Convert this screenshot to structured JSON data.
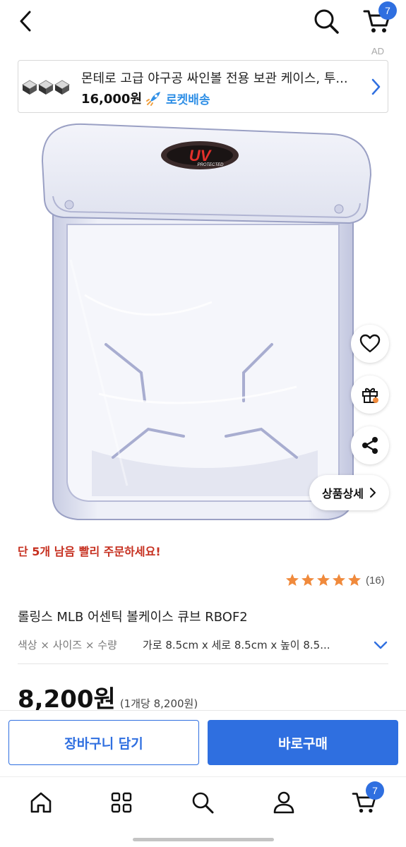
{
  "header": {
    "cart_badge": "7"
  },
  "ad": {
    "label": "AD",
    "title": "몬테로 고급 야구공 싸인볼 전용 보관 케이스, 투...",
    "price": "16,000원",
    "delivery_label": "로켓배송"
  },
  "product_image": {
    "logo_text": "UV",
    "logo_subtext": "PROTECTED"
  },
  "side_actions": {
    "detail_label": "상품상세"
  },
  "stock_warning": "단 5개 남음 빨리 주문하세요!",
  "rating": {
    "stars": 5,
    "count": "(16)"
  },
  "product": {
    "name": "롤링스 MLB 어센틱 볼케이스 큐브 RBOF2",
    "option_label": "색상 × 사이즈 × 수량",
    "option_value": "가로 8.5cm x 세로 8.5cm x 높이 8.5...",
    "price": "8,200원",
    "unit_price": "(1개당 8,200원)"
  },
  "buybar": {
    "add_to_cart": "장바구니 담기",
    "buy_now": "바로구매"
  },
  "bottom_nav": {
    "cart_badge": "7"
  },
  "colors": {
    "accent": "#2f6fe0",
    "warning": "#c62f1f",
    "star": "#f08a3c",
    "rocket": "#2f8fe6"
  }
}
